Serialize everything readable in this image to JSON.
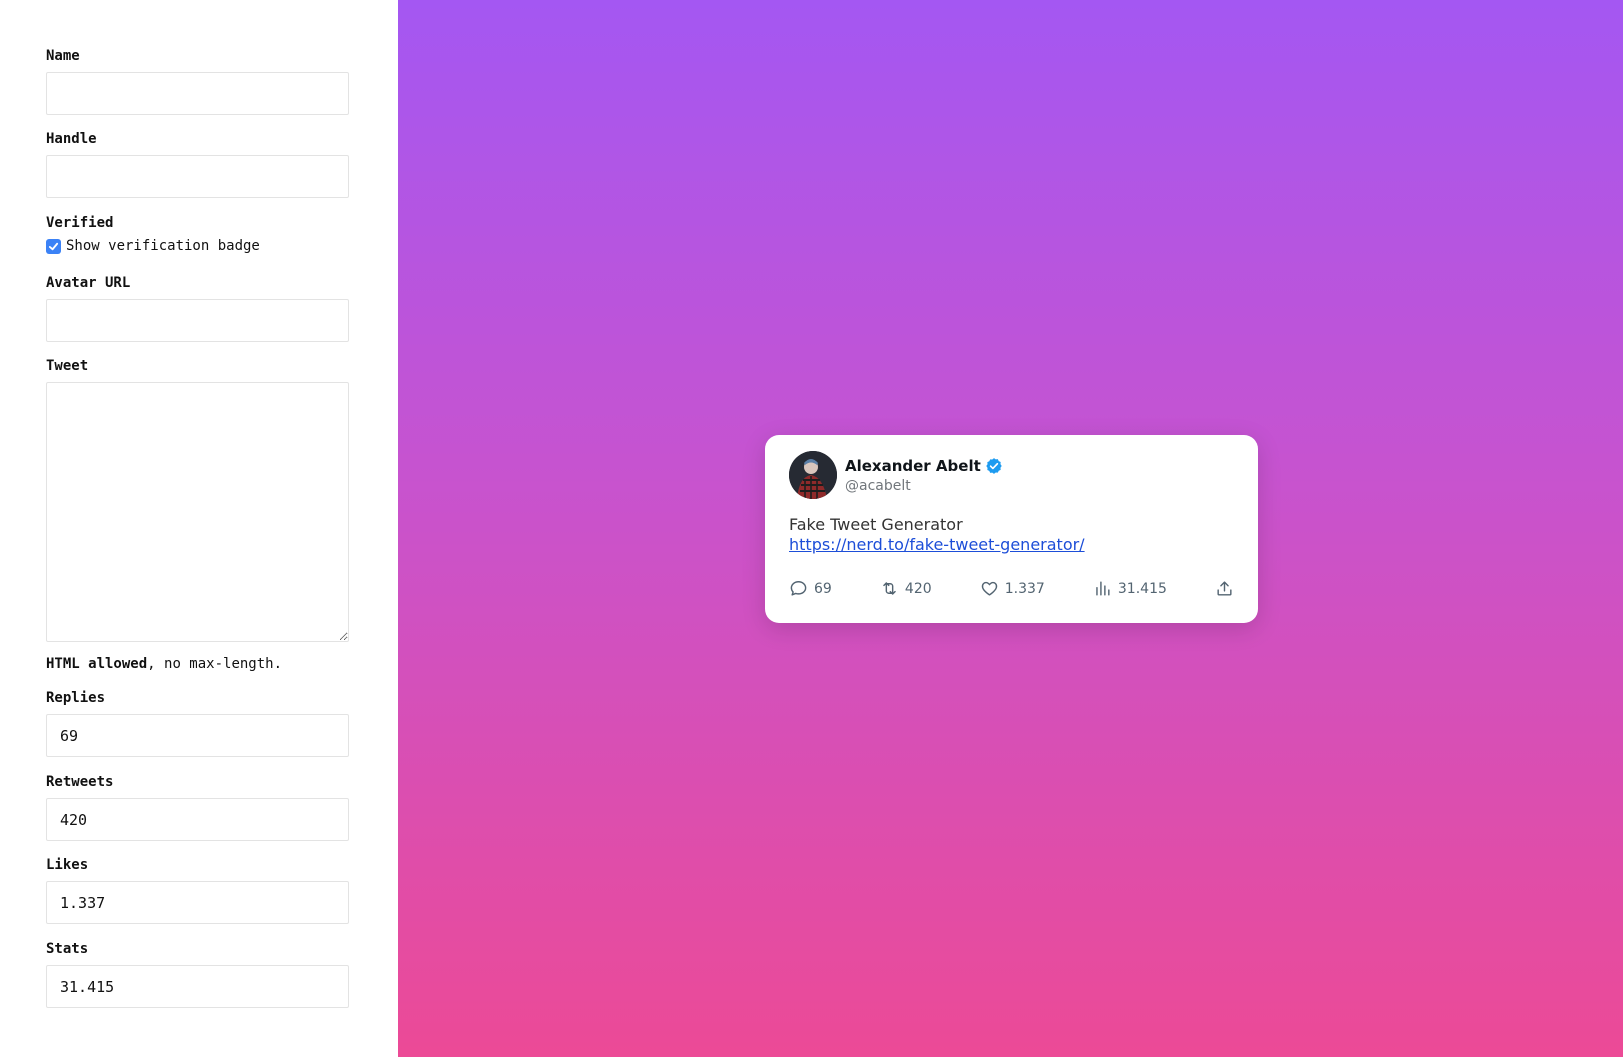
{
  "form": {
    "name_label": "Name",
    "name_value": "",
    "handle_label": "Handle",
    "handle_value": "",
    "verified_label": "Verified",
    "verified_checkbox_label": "Show verification badge",
    "verified_checked": true,
    "avatar_label": "Avatar URL",
    "avatar_value": "",
    "tweet_label": "Tweet",
    "tweet_value": "",
    "hint_bold": "HTML allowed",
    "hint_rest": ", no max-length.",
    "replies_label": "Replies",
    "replies_value": "69",
    "retweets_label": "Retweets",
    "retweets_value": "420",
    "likes_label": "Likes",
    "likes_value": "1.337",
    "stats_label": "Stats",
    "stats_value": "31.415"
  },
  "preview": {
    "name": "Alexander Abelt",
    "handle": "@acabelt",
    "tweet_text": "Fake Tweet Generator",
    "tweet_link": "https://nerd.to/fake-tweet-generator/",
    "replies": "69",
    "retweets": "420",
    "likes": "1.337",
    "stats": "31.415"
  },
  "colors": {
    "gradient_top": "#a457f2",
    "gradient_bottom": "#ec4a96",
    "verified_badge": "#1d9bf0",
    "link": "#1d4ed8",
    "checkbox": "#3b82f6"
  },
  "icons": [
    "check-icon",
    "verified-badge-icon",
    "reply-icon",
    "retweet-icon",
    "like-icon",
    "stats-icon",
    "share-icon"
  ]
}
